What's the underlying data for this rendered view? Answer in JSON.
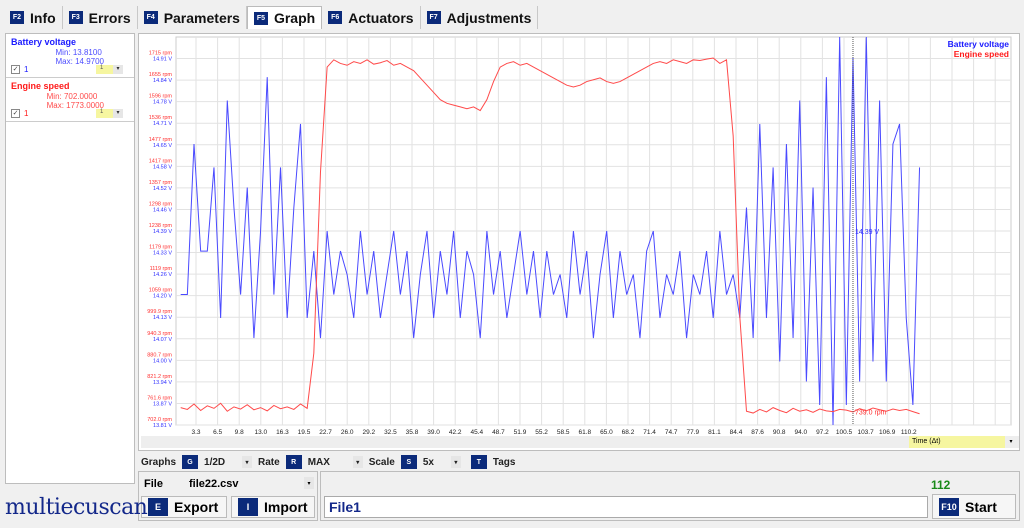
{
  "tabs": [
    {
      "key": "F2",
      "label": "Info"
    },
    {
      "key": "F3",
      "label": "Errors"
    },
    {
      "key": "F4",
      "label": "Parameters"
    },
    {
      "key": "F5",
      "label": "Graph",
      "active": true
    },
    {
      "key": "F6",
      "label": "Actuators"
    },
    {
      "key": "F7",
      "label": "Adjustments"
    }
  ],
  "params": [
    {
      "name": "Battery voltage",
      "min": "Min: 13.8100",
      "max": "Max: 14.9700",
      "checked": true,
      "index": "1",
      "select": "1",
      "color": "#1a1aff"
    },
    {
      "name": "Engine speed",
      "min": "Min: 702.0000",
      "max": "Max: 1773.0000",
      "checked": true,
      "index": "1",
      "select": "1",
      "color": "#ff1a1a"
    }
  ],
  "toolbar": {
    "graphs_label": "Graphs",
    "graphs_key": "G",
    "graphs_value": "1/2D",
    "rate_label": "Rate",
    "rate_key": "R",
    "rate_value": "MAX",
    "scale_label": "Scale",
    "scale_key": "S",
    "scale_value": "5x",
    "tags_key": "T",
    "tags_label": "Tags"
  },
  "file": {
    "label": "File",
    "value": "file22.csv",
    "export_key": "E",
    "export_label": "Export",
    "import_key": "I",
    "import_label": "Import"
  },
  "record": {
    "name": "File1",
    "count": "112",
    "start_key": "F10",
    "start_label": "Start"
  },
  "x_axis_select": "Time (Δt)",
  "logo": "multiecuscan",
  "chart_data": {
    "type": "line",
    "xlabel": "Time (Δt)",
    "x_ticks": [
      "3.3",
      "6.5",
      "9.8",
      "13.0",
      "16.3",
      "19.5",
      "22.7",
      "26.0",
      "29.2",
      "32.5",
      "35.8",
      "39.0",
      "42.2",
      "45.4",
      "48.7",
      "51.9",
      "55.2",
      "58.5",
      "61.8",
      "65.0",
      "68.2",
      "71.4",
      "74.7",
      "77.9",
      "81.1",
      "84.4",
      "87.6",
      "90.8",
      "94.0",
      "97.2",
      "100.5",
      "103.7",
      "106.9",
      "110.2"
    ],
    "y_ticks_rpm": [
      "702.0 rpm",
      "761.6 rpm",
      "821.2 rpm",
      "880.7 rpm",
      "940.3 rpm",
      "999.9 rpm",
      "1059 rpm",
      "1119 rpm",
      "1179 rpm",
      "1238 rpm",
      "1298 rpm",
      "1357 rpm",
      "1417 rpm",
      "1477 rpm",
      "1536 rpm",
      "1596 rpm",
      "1655 rpm",
      "1715 rpm"
    ],
    "y_ticks_v": [
      "13.81 V",
      "13.87 V",
      "13.94 V",
      "14.00 V",
      "14.07 V",
      "14.13 V",
      "14.20 V",
      "14.26 V",
      "14.33 V",
      "14.39 V",
      "14.46 V",
      "14.52 V",
      "14.58 V",
      "14.65 V",
      "14.71 V",
      "14.78 V",
      "14.84 V",
      "14.91 V"
    ],
    "ylim_rpm": [
      702,
      1773
    ],
    "ylim_v": [
      13.81,
      14.97
    ],
    "xlim": [
      0.4,
      125
    ],
    "grid": true,
    "legend": "top-right",
    "cursor": {
      "x": 102,
      "v_label": "14.39 V",
      "rpm_label": "739.0 rpm"
    },
    "series": [
      {
        "name": "Battery voltage",
        "color": "#4a4aff",
        "values": [
          14.2,
          14.2,
          14.65,
          14.33,
          14.33,
          14.58,
          14.13,
          14.78,
          14.46,
          14.2,
          14.52,
          14.07,
          14.39,
          14.85,
          14.2,
          14.58,
          14.13,
          14.46,
          14.71,
          14.13,
          14.33,
          14.07,
          14.39,
          14.2,
          14.33,
          14.26,
          14.13,
          14.39,
          14.2,
          14.33,
          14.13,
          14.26,
          14.39,
          14.2,
          14.33,
          14.07,
          14.26,
          14.39,
          14.13,
          14.33,
          14.2,
          14.39,
          14.13,
          14.33,
          14.26,
          14.07,
          14.39,
          14.2,
          14.33,
          14.13,
          14.26,
          14.39,
          14.2,
          14.33,
          14.13,
          14.33,
          14.2,
          14.26,
          14.13,
          14.39,
          14.2,
          14.33,
          14.07,
          14.26,
          14.39,
          14.13,
          14.33,
          14.2,
          14.26,
          14.07,
          14.33,
          14.39,
          14.13,
          14.26,
          14.2,
          14.33,
          14.07,
          14.26,
          14.2,
          14.33,
          14.13,
          14.39,
          14.2,
          14.26,
          14.13,
          14.46,
          14.07,
          14.71,
          14.13,
          14.58,
          14.0,
          14.65,
          14.07,
          14.78,
          13.94,
          14.52,
          13.87,
          14.85,
          13.81,
          14.97,
          13.87,
          14.91,
          13.94,
          14.97,
          14.0,
          14.78,
          13.94,
          14.65,
          14.71,
          14.13,
          13.87,
          14.58
        ]
      },
      {
        "name": "Engine speed",
        "color": "#ff4a4a",
        "values": [
          750,
          745,
          760,
          742,
          755,
          748,
          762,
          740,
          752,
          746,
          758,
          744,
          750,
          741,
          756,
          747,
          752,
          745,
          760,
          748,
          900,
          1400,
          1690,
          1710,
          1700,
          1695,
          1705,
          1700,
          1710,
          1698,
          1702,
          1708,
          1695,
          1700,
          1690,
          1680,
          1660,
          1640,
          1620,
          1600,
          1590,
          1585,
          1580,
          1575,
          1580,
          1570,
          1600,
          1650,
          1690,
          1700,
          1705,
          1695,
          1700,
          1690,
          1680,
          1670,
          1660,
          1650,
          1640,
          1635,
          1640,
          1650,
          1655,
          1660,
          1650,
          1645,
          1650,
          1660,
          1670,
          1680,
          1690,
          1700,
          1705,
          1700,
          1710,
          1705,
          1700,
          1710,
          1708,
          1712,
          1715,
          1700,
          1710,
          1500,
          1000,
          740,
          735,
          745,
          738,
          750,
          742,
          736,
          748,
          740,
          744,
          737,
          746,
          741,
          739,
          745,
          743,
          738,
          747,
          741,
          749,
          744,
          740,
          746,
          742,
          745,
          739,
          733
        ]
      }
    ]
  }
}
